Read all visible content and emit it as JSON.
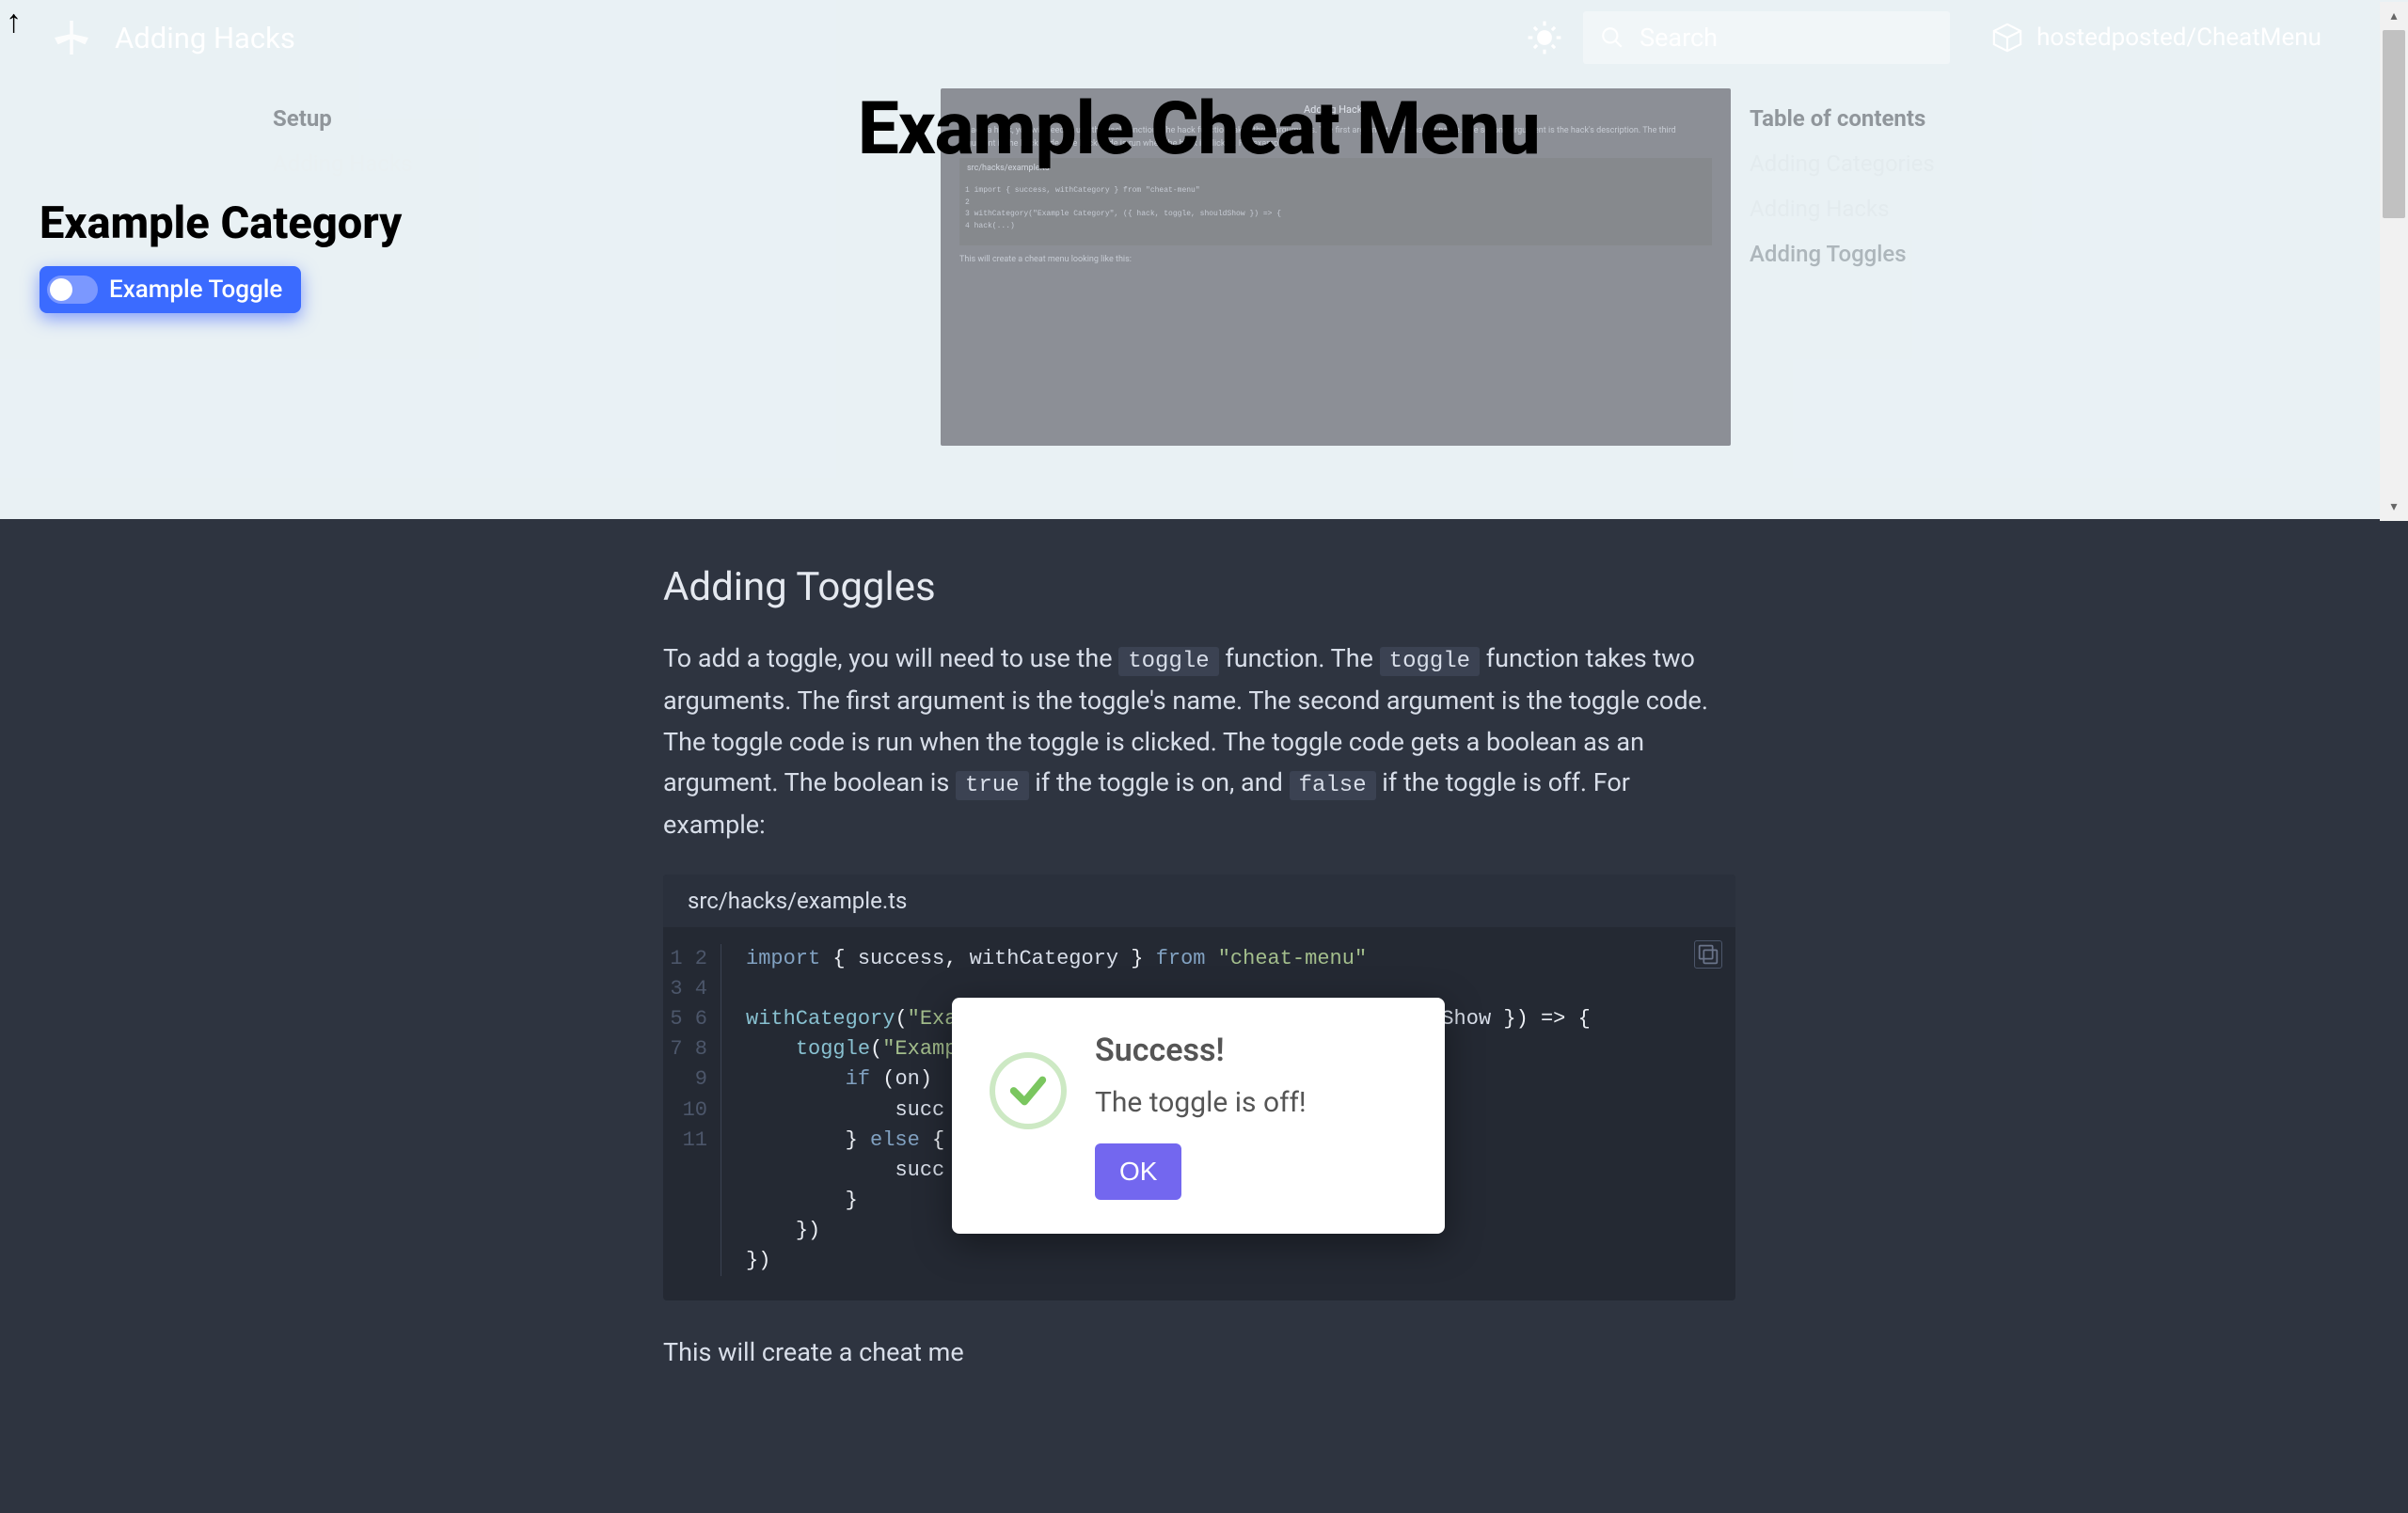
{
  "header": {
    "title": "Adding Hacks",
    "search_placeholder": "Search",
    "repo": "hostedposted/CheatMenu"
  },
  "sidebar": {
    "setup": "Setup",
    "items": [
      "Adding Hacks"
    ]
  },
  "toc": {
    "title": "Table of contents",
    "items": [
      {
        "label": "Adding Categories",
        "active": false
      },
      {
        "label": "Adding Hacks",
        "active": false
      },
      {
        "label": "Adding Toggles",
        "active": true
      }
    ]
  },
  "overlay": {
    "menu_title": "Example Cheat Menu",
    "category_title": "Example Category",
    "toggle_label": "Example Toggle"
  },
  "preview": {
    "header_text": "Adding Hacks",
    "body_text": "To add a hack, you will need to use the hack function. The hack function takes three arguments. The first argument is the hack's name. The second argument is the hack's description. The third argument is the hack code. The hack code is run when the hack is clicked. For example:",
    "file_label": "src/hacks/example.ts",
    "footer_text": "This will create a cheat menu looking like this:"
  },
  "section": {
    "heading": "Adding Toggles",
    "para_parts": {
      "p1": "To add a toggle, you will need to use the ",
      "c1": "toggle",
      "p2": " function. The ",
      "c2": "toggle",
      "p3": " function takes two arguments. The first argument is the toggle's name. The second argument is the toggle code. The toggle code is run when the toggle is clicked. The toggle code gets a boolean as an argument. The boolean is ",
      "c3": "true",
      "p4": " if the toggle is on, and ",
      "c4": "false",
      "p5": " if the toggle is off. For example:"
    },
    "code_filename": "src/hacks/example.ts",
    "code_lines": [
      "import { success, withCategory } from \"cheat-menu\"",
      "",
      "withCategory(\"Example Category\", ({ hack, toggle, shouldShow }) => {",
      "    toggle(\"Example Toggle\", (on) => {",
      "        if (on) {",
      "            succ",
      "        } else {",
      "            succ",
      "        }",
      "    })",
      "})"
    ],
    "after_para": "This will create a cheat me"
  },
  "modal": {
    "title": "Success!",
    "text": "The toggle is off!",
    "ok": "OK"
  },
  "colors": {
    "hero_bg": "#d7e5ec",
    "dark_bg": "#2e3440",
    "code_bg": "#242933",
    "accent_blue": "#3b6bff",
    "modal_btn": "#7367ef",
    "string_green": "#a3be8c",
    "keyword": "#81a1c1"
  }
}
